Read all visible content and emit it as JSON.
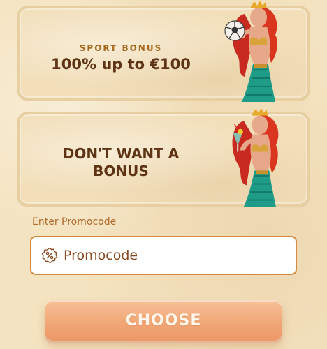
{
  "sport_bonus": {
    "eyebrow": "SPORT BONUS",
    "title": "100% up to €100"
  },
  "no_bonus": {
    "title_line1": "DON'T WANT A",
    "title_line2": "BONUS"
  },
  "promo": {
    "label": "Enter Promocode",
    "placeholder": "Promocode",
    "icon": "percent-badge-icon"
  },
  "choose_button": {
    "label": "CHOOSE"
  },
  "colors": {
    "background": "#f4e3c0",
    "card": "#f2dfba",
    "title": "#5e3414",
    "accent": "#d58a3f",
    "button": "#f1a777"
  }
}
